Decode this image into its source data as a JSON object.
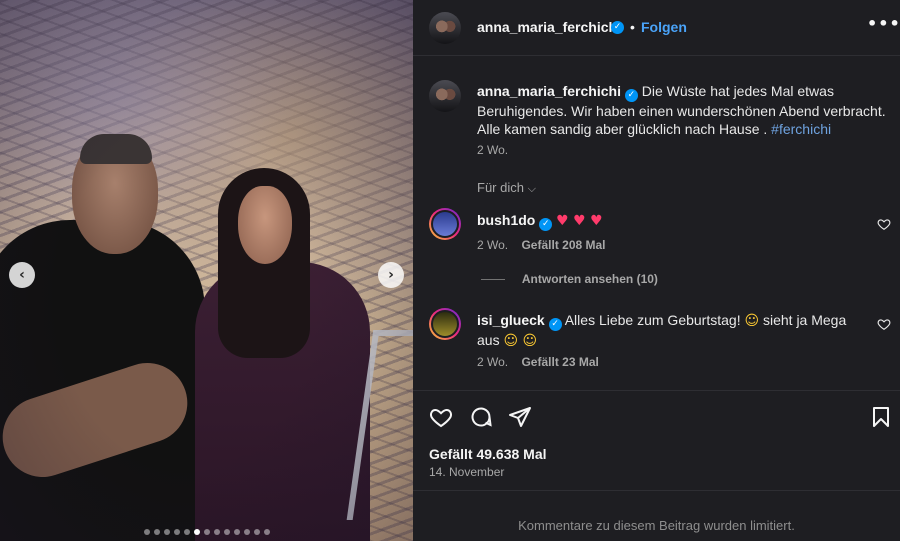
{
  "photo": {
    "nav_prev_icon": "chevron-left-icon",
    "nav_next_icon": "chevron-right-icon",
    "carousel_count": 13,
    "carousel_active_index": 5,
    "glyphs": {
      "prev": "‹",
      "next": "›"
    }
  },
  "header": {
    "username": "anna_maria_ferchichi",
    "separator": "•",
    "follow_label": "Folgen",
    "more_glyph": "•••"
  },
  "caption": {
    "username": "anna_maria_ferchichi",
    "text": "Die Wüste hat jedes Mal etwas Beruhigendes. Wir haben einen wunderschönen Abend verbracht. Alle kamen sandig aber glücklich nach Hause .",
    "hashtag": "#ferchichi",
    "time": "2 Wo."
  },
  "filter": {
    "label": "Für dich",
    "chevron": "⌵"
  },
  "comments": [
    {
      "username": "bush1do",
      "text": "♥ ♥ ♥",
      "time": "2 Wo.",
      "likes": "Gefällt 208 Mal",
      "replies_label": "Antworten ansehen (10)"
    },
    {
      "username": "isi_glueck",
      "text_before": "Alles Liebe zum Geburtstag!",
      "emoji_1": "☺",
      "text_after": "sieht ja Mega aus",
      "emoji_2": "☺ ☺",
      "time": "2 Wo.",
      "likes": "Gefällt 23 Mal"
    }
  ],
  "post": {
    "likes": "Gefällt 49.638 Mal",
    "date": "14. November",
    "comments_limited": "Kommentare zu diesem Beitrag wurden limitiert."
  },
  "colors": {
    "panel_bg": "#1e1e22",
    "verified": "#0095f6",
    "follow": "#4aa3f8",
    "hashtag": "#6fa3e0",
    "heart": "#ff3b6b"
  },
  "verified_glyph": "✓"
}
